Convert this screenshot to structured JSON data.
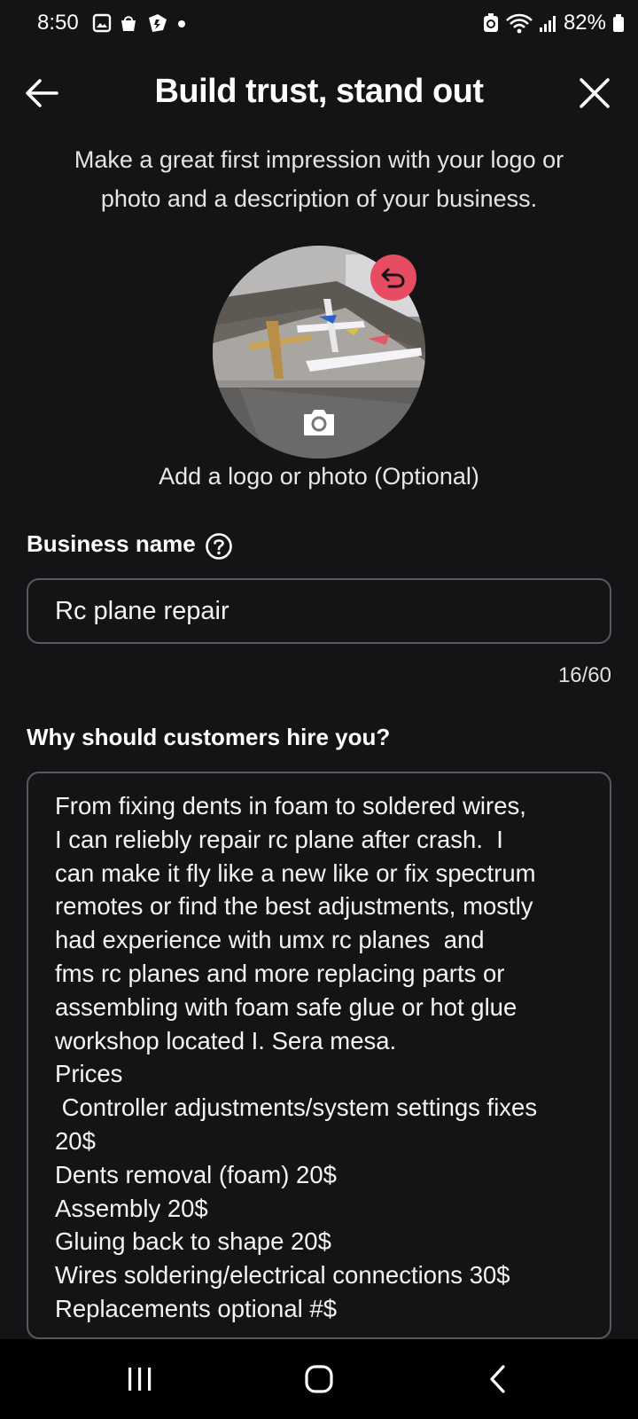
{
  "status_bar": {
    "time": "8:50",
    "battery": "82%",
    "left_icons": [
      "image-icon",
      "bag-icon",
      "shield-bolt-icon",
      "dot-icon"
    ],
    "right_icons": [
      "battery-saver-icon",
      "wifi-icon",
      "signal-icon",
      "battery-icon"
    ]
  },
  "header": {
    "title": "Build trust, stand out",
    "back_icon": "arrow-left-icon",
    "close_icon": "close-icon"
  },
  "intro": {
    "line1": "Make a great first impression with your logo or",
    "line2": "photo and a description of your business."
  },
  "photo": {
    "caption": "Add a logo or photo (Optional)",
    "undo_icon": "undo-icon",
    "camera_icon": "camera-icon",
    "accent": "#e74c62"
  },
  "business_name": {
    "label": "Business name",
    "help_icon": "question-circle-icon",
    "value": "Rc plane repair",
    "count": "16/60"
  },
  "why_hire": {
    "label": "Why should customers hire you?",
    "value": "From fixing dents in foam to soldered wires,\nI can reliebly repair rc plane after crash.  I\ncan make it fly like a new like or fix spectrum\nremotes or find the best adjustments, mostly\nhad experience with umx rc planes  and\nfms rc planes and more replacing parts or\nassembling with foam safe glue or hot glue\nworkshop located I. Sera mesa.\nPrices\n Controller adjustments/system settings fixes\n20$\nDents removal (foam) 20$\nAssembly 20$\nGluing back to shape 20$\nWires soldering/electrical connections 30$\nReplacements optional #$"
  },
  "nav_bar": {
    "recents_icon": "recents-icon",
    "home_icon": "home-icon",
    "back_icon": "nav-back-icon"
  }
}
